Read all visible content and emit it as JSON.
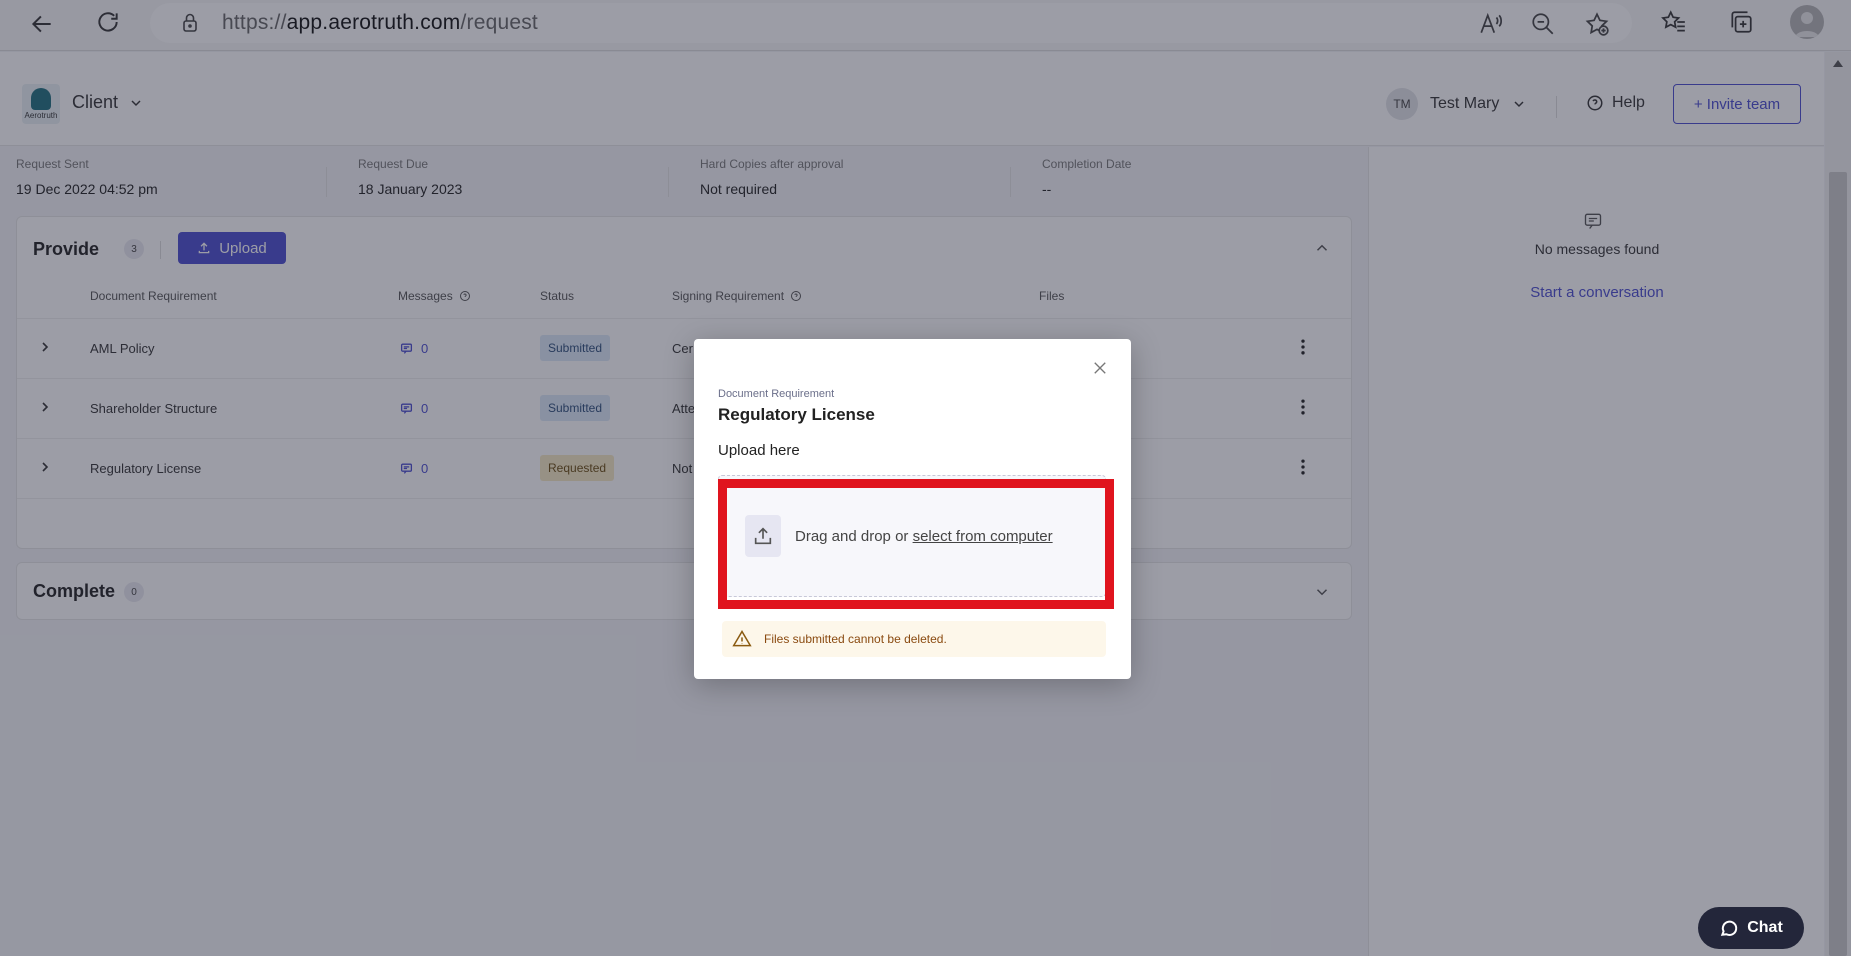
{
  "browser": {
    "url_prefix": "https://",
    "url_host": "app.aerotruth.com",
    "url_path": "/request"
  },
  "header": {
    "logo_word": "Aerotruth",
    "client_label": "Client",
    "user_initials": "TM",
    "user_name": "Test Mary",
    "help_label": "Help",
    "invite_label": "+ Invite team"
  },
  "meta": [
    {
      "label": "Request Sent",
      "value": "19 Dec 2022 04:52 pm"
    },
    {
      "label": "Request Due",
      "value": "18 January 2023"
    },
    {
      "label": "Hard Copies after approval",
      "value": "Not required"
    },
    {
      "label": "Completion Date",
      "value": "--"
    }
  ],
  "provide": {
    "title": "Provide",
    "count": "3",
    "upload_label": "Upload",
    "columns": [
      "Document Requirement",
      "Messages",
      "Status",
      "Signing Requirement",
      "Files"
    ],
    "rows": [
      {
        "name": "AML Policy",
        "messages": "0",
        "status": "Submitted",
        "signing": "Cer"
      },
      {
        "name": "Shareholder Structure",
        "messages": "0",
        "status": "Submitted",
        "signing": "Atte"
      },
      {
        "name": "Regulatory License",
        "messages": "0",
        "status": "Requested",
        "signing": "Not"
      }
    ]
  },
  "complete": {
    "title": "Complete",
    "count": "0"
  },
  "messages_pane": {
    "empty_text": "No messages found",
    "start_link": "Start a conversation"
  },
  "modal": {
    "eyebrow": "Document Requirement",
    "title": "Regulatory License",
    "upload_label": "Upload here",
    "drop_text": "Drag and drop or ",
    "drop_link": "select from computer",
    "warning": "Files submitted cannot be deleted."
  },
  "chat": {
    "label": "Chat"
  },
  "colors": {
    "accent": "#4b4ed0",
    "highlight": "#e0141e",
    "overlay": "#23263a"
  }
}
